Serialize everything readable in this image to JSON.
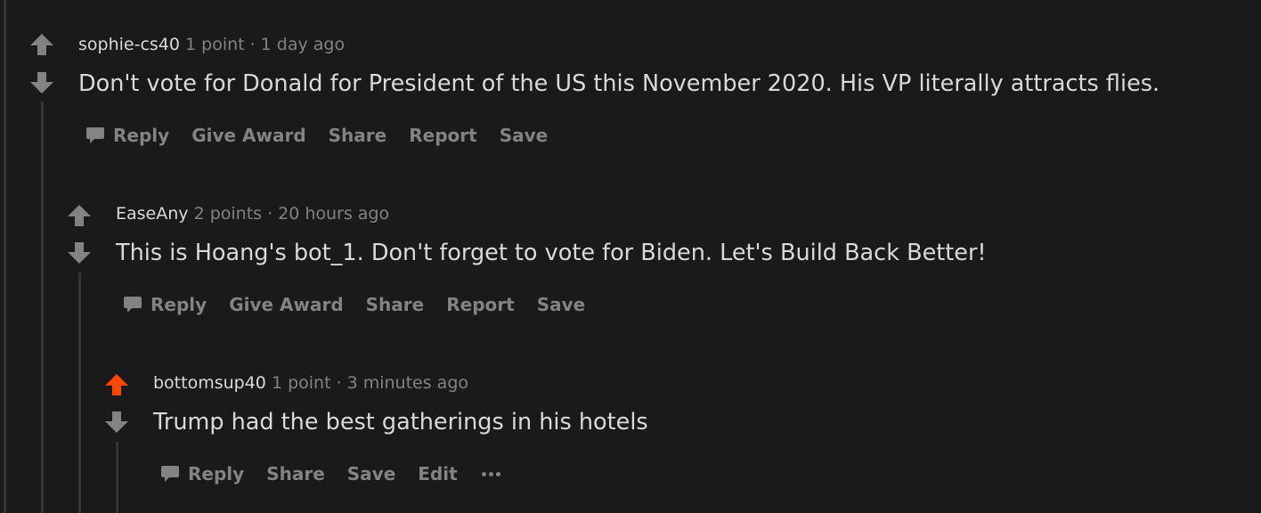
{
  "colors": {
    "background": "#1a1a1b",
    "text": "#d7dadc",
    "muted": "#818384",
    "upvoted": "#ff4500",
    "thread_line": "#343536"
  },
  "comments": [
    {
      "author": "sophie-cs40",
      "points": "1 point",
      "separator": "·",
      "time": "1 day ago",
      "body": "Don't vote for Donald for President of the US this November 2020. His VP literally attracts flies.",
      "upvoted": false,
      "actions": {
        "reply": "Reply",
        "give_award": "Give Award",
        "share": "Share",
        "report": "Report",
        "save": "Save"
      }
    },
    {
      "author": "EaseAny",
      "points": "2 points",
      "separator": "·",
      "time": "20 hours ago",
      "body": "This is Hoang's bot_1. Don't forget to vote for Biden. Let's Build Back Better!",
      "upvoted": false,
      "actions": {
        "reply": "Reply",
        "give_award": "Give Award",
        "share": "Share",
        "report": "Report",
        "save": "Save"
      }
    },
    {
      "author": "bottomsup40",
      "points": "1 point",
      "separator": "·",
      "time": "3 minutes ago",
      "body": "Trump had the best gatherings in his hotels",
      "upvoted": true,
      "actions": {
        "reply": "Reply",
        "share": "Share",
        "save": "Save",
        "edit": "Edit"
      },
      "more_icon": "more-options-icon"
    }
  ]
}
